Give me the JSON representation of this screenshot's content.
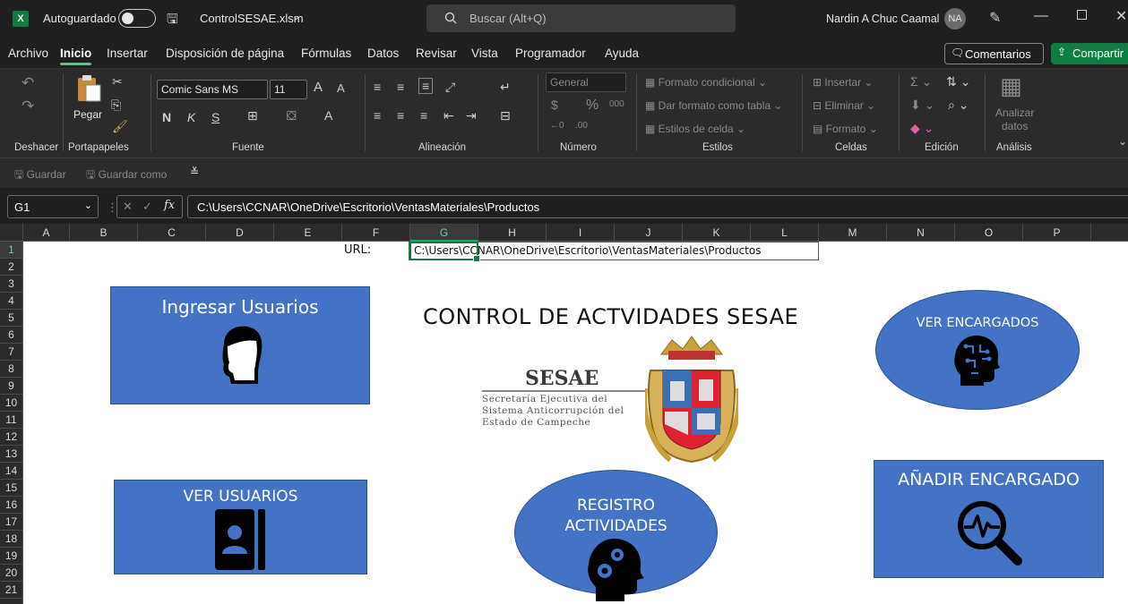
{
  "titlebar": {
    "autosave_label": "Autoguardado",
    "filename": "ControlSESAE.xlsm",
    "search_placeholder": "Buscar (Alt+Q)",
    "user_name": "Nardin A Chuc Caamal",
    "user_initials": "NA"
  },
  "menu": {
    "items": [
      "Archivo",
      "Inicio",
      "Insertar",
      "Disposición de página",
      "Fórmulas",
      "Datos",
      "Revisar",
      "Vista",
      "Programador",
      "Ayuda"
    ],
    "active": "Inicio",
    "comments_label": "Comentarios",
    "share_label": "Compartir"
  },
  "ribbon": {
    "groups": {
      "undo": "Deshacer",
      "clipboard": "Portapapeles",
      "font": "Fuente",
      "alignment": "Alineación",
      "number": "Número",
      "styles": "Estilos",
      "cells": "Celdas",
      "editing": "Edición",
      "analysis": "Análisis"
    },
    "paste_label": "Pegar",
    "font_name": "Comic Sans MS",
    "font_size": "11",
    "number_format": "General",
    "conditional_format": "Formato condicional",
    "format_as_table": "Dar formato como tabla",
    "cell_styles": "Estilos de celda",
    "insert": "Insertar",
    "delete": "Eliminar",
    "format": "Formato",
    "analyze_data_line1": "Analizar",
    "analyze_data_line2": "datos",
    "bold": "N",
    "italic": "K",
    "underline": "S"
  },
  "qat": {
    "save": "Guardar",
    "save_as": "Guardar como"
  },
  "formula_bar": {
    "name_box": "G1",
    "fx": "fx",
    "value": "C:\\Users\\CCNAR\\OneDrive\\Escritorio\\VentasMateriales\\Productos"
  },
  "columns": [
    "A",
    "B",
    "C",
    "D",
    "E",
    "F",
    "G",
    "H",
    "I",
    "J",
    "K",
    "L",
    "M",
    "N",
    "O",
    "P"
  ],
  "selected_column": "G",
  "rows": [
    "1",
    "2",
    "3",
    "4",
    "5",
    "6",
    "7",
    "8",
    "9",
    "10",
    "11",
    "12",
    "13",
    "14",
    "15",
    "16",
    "17",
    "18",
    "19",
    "20",
    "21"
  ],
  "selected_row": "1",
  "sheet": {
    "url_label": "URL:",
    "url_value": "C:\\Users\\CCNAR\\OneDrive\\Escritorio\\VentasMateriales\\Productos",
    "title": "CONTROL DE ACTVIDADES SESAE",
    "logo_name": "SESAE",
    "logo_line1": "Secretaría Ejecutiva del",
    "logo_line2": "Sistema Anticorrupción del",
    "logo_line3": "Estado de Campeche",
    "buttons": {
      "add_users": "Ingresar Usuarios",
      "view_users": "VER USUARIOS",
      "view_managers": "VER ENCARGADOS",
      "add_manager": "AÑADIR ENCARGADO",
      "activity_register_line1": "REGISTRO",
      "activity_register_line2": "ACTIVIDADES"
    },
    "shape_fill": "#4472c4"
  }
}
